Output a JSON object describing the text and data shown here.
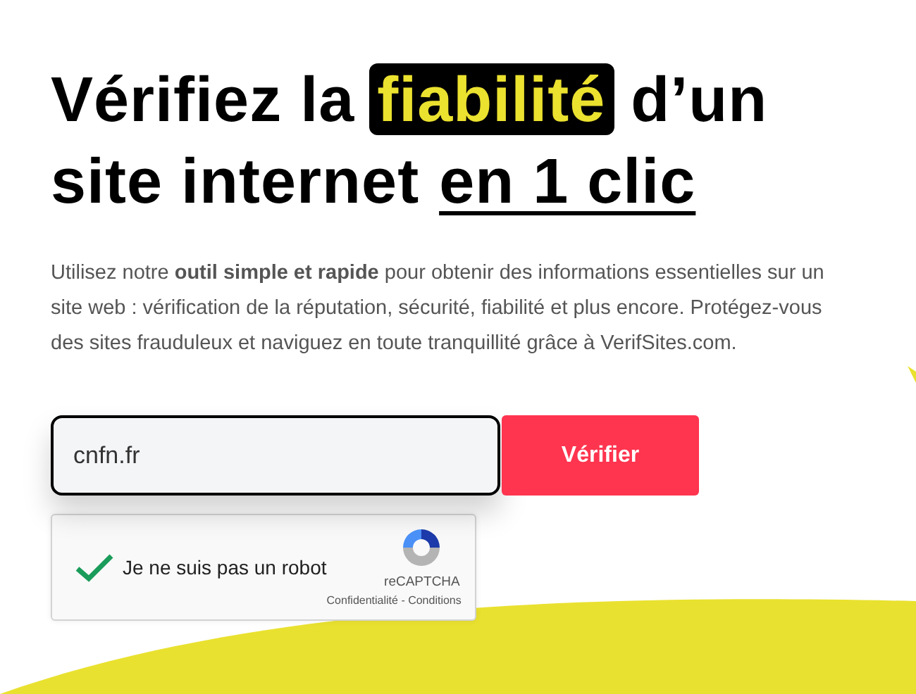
{
  "headline": [
    {
      "kind": "plain",
      "text": "Vérifiez la"
    },
    {
      "kind": "highlight",
      "text": "fiabilité"
    },
    {
      "kind": "plain",
      "text": "d’un"
    },
    {
      "kind": "break",
      "text": "site internet"
    },
    {
      "kind": "underline",
      "text": "en 1 clic"
    }
  ],
  "intro": "Utilisez notre **outil simple et rapide** pour obtenir des informations essentielles sur un site web : vérification de la réputation, sécurité, fiabilité et plus encore. Protégez-vous des sites frauduleux et naviguez en toute tranquillité grâce à VerifSites.com.",
  "search": {
    "value": "cnfn.fr",
    "button": "Vérifier"
  },
  "captcha": {
    "label": "Je ne suis pas un robot",
    "checked": true,
    "brand": "reCAPTCHA",
    "links": "Confidentialité - Conditions"
  }
}
